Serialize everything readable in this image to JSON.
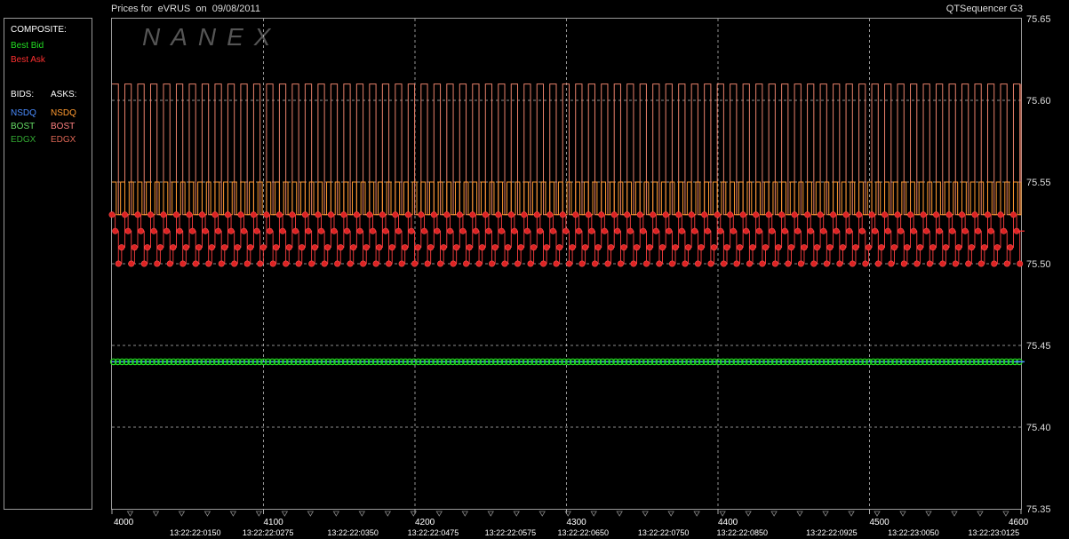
{
  "header": {
    "title": "Prices for  eVRUS  on  09/08/2011",
    "app_name": "QTSequencer G3"
  },
  "watermark": "NANEX",
  "legend": {
    "composite_heading": "COMPOSITE:",
    "best_bid": "Best Bid",
    "best_ask": "Best Ask",
    "bids_heading": "BIDS:",
    "asks_heading": "ASKS:",
    "bids": [
      "NSDQ",
      "BOST",
      "EDGX"
    ],
    "asks": [
      "NSDQ",
      "BOST",
      "EDGX"
    ]
  },
  "colors": {
    "best_bid": "#22dd22",
    "best_ask": "#ff3030",
    "nsdq_bid": "#4a8cff",
    "nsdq_ask": "#ff9a30",
    "bost_bid": "#66dd66",
    "bost_ask": "#ff8080",
    "edgx_bid": "#33aa33",
    "edgx_ask": "#dd6655",
    "grid": "#bbbbbb"
  },
  "chart_data": {
    "type": "line",
    "title": "Prices for  eVRUS  on  09/08/2011",
    "x_range": [
      4000,
      4600
    ],
    "y_range": [
      75.35,
      75.65
    ],
    "y_ticks": [
      "75.65",
      "75.60",
      "75.55",
      "75.50",
      "75.45",
      "75.40",
      "75.35"
    ],
    "y_grid_values": [
      75.6,
      75.55,
      75.5,
      75.45,
      75.4
    ],
    "x_ticks": [
      "4000",
      "4100",
      "4200",
      "4300",
      "4400",
      "4500",
      "4600"
    ],
    "x_tick_values": [
      4000,
      4100,
      4200,
      4300,
      4400,
      4500,
      4600
    ],
    "time_labels": [
      "13:22:22:0150",
      "13:22:22:0275",
      "13:22:22:0350",
      "13:22:22:0475",
      "13:22:22:0575",
      "13:22:22:0650",
      "13:22:22:0750",
      "13:22:22:0850",
      "13:22:22:0925",
      "13:22:23:0050",
      "13:22:23:0125"
    ],
    "time_label_x": [
      4055,
      4103,
      4159,
      4212,
      4263,
      4311,
      4364,
      4416,
      4475,
      4529,
      4582
    ],
    "series": [
      {
        "name": "Best Bid",
        "price": 75.44,
        "cycle": 8.5
      },
      {
        "name": "NSDQ ask",
        "high": 75.61,
        "low": 75.53,
        "cycle": 8.5
      },
      {
        "name": "BOST ask",
        "high": 75.55,
        "low": 75.53,
        "cycle": 8.5
      },
      {
        "name": "Best Ask",
        "levels": [
          75.53,
          75.52,
          75.5,
          75.51
        ],
        "cycle": 8.5
      }
    ],
    "grid": true,
    "legend_position": "left"
  }
}
